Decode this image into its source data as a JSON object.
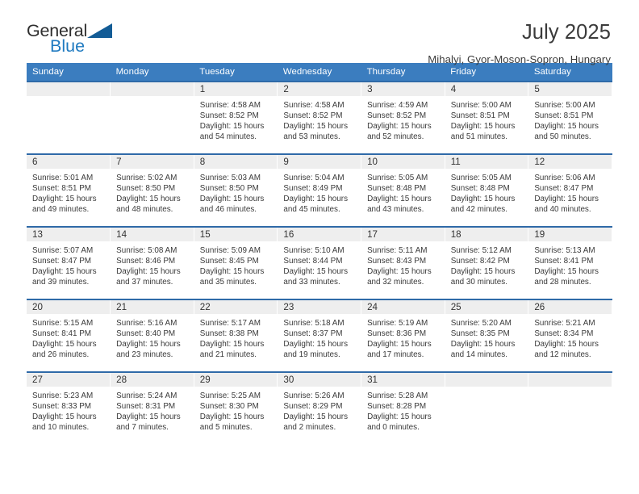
{
  "brand": {
    "name_top": "General",
    "name_bottom": "Blue",
    "accent_color": "#1f7ac0",
    "triangle_color": "#135c96"
  },
  "header": {
    "title": "July 2025",
    "subtitle": "Mihalyi, Gyor-Moson-Sopron, Hungary"
  },
  "theme": {
    "header_row_bg": "#3b7dbf",
    "week_rule": "#2f6aa8",
    "daynum_bg": "#eeeeee",
    "text": "#3a3a3a"
  },
  "weekday_headers": [
    "Sunday",
    "Monday",
    "Tuesday",
    "Wednesday",
    "Thursday",
    "Friday",
    "Saturday"
  ],
  "labels": {
    "sunrise_prefix": "Sunrise:",
    "sunset_prefix": "Sunset:",
    "daylight_prefix": "Daylight:"
  },
  "weeks": [
    [
      {
        "day": "",
        "empty": true
      },
      {
        "day": "",
        "empty": true
      },
      {
        "day": "1",
        "sunrise": "Sunrise: 4:58 AM",
        "sunset": "Sunset: 8:52 PM",
        "daylight": "Daylight: 15 hours and 54 minutes."
      },
      {
        "day": "2",
        "sunrise": "Sunrise: 4:58 AM",
        "sunset": "Sunset: 8:52 PM",
        "daylight": "Daylight: 15 hours and 53 minutes."
      },
      {
        "day": "3",
        "sunrise": "Sunrise: 4:59 AM",
        "sunset": "Sunset: 8:52 PM",
        "daylight": "Daylight: 15 hours and 52 minutes."
      },
      {
        "day": "4",
        "sunrise": "Sunrise: 5:00 AM",
        "sunset": "Sunset: 8:51 PM",
        "daylight": "Daylight: 15 hours and 51 minutes."
      },
      {
        "day": "5",
        "sunrise": "Sunrise: 5:00 AM",
        "sunset": "Sunset: 8:51 PM",
        "daylight": "Daylight: 15 hours and 50 minutes."
      }
    ],
    [
      {
        "day": "6",
        "sunrise": "Sunrise: 5:01 AM",
        "sunset": "Sunset: 8:51 PM",
        "daylight": "Daylight: 15 hours and 49 minutes."
      },
      {
        "day": "7",
        "sunrise": "Sunrise: 5:02 AM",
        "sunset": "Sunset: 8:50 PM",
        "daylight": "Daylight: 15 hours and 48 minutes."
      },
      {
        "day": "8",
        "sunrise": "Sunrise: 5:03 AM",
        "sunset": "Sunset: 8:50 PM",
        "daylight": "Daylight: 15 hours and 46 minutes."
      },
      {
        "day": "9",
        "sunrise": "Sunrise: 5:04 AM",
        "sunset": "Sunset: 8:49 PM",
        "daylight": "Daylight: 15 hours and 45 minutes."
      },
      {
        "day": "10",
        "sunrise": "Sunrise: 5:05 AM",
        "sunset": "Sunset: 8:48 PM",
        "daylight": "Daylight: 15 hours and 43 minutes."
      },
      {
        "day": "11",
        "sunrise": "Sunrise: 5:05 AM",
        "sunset": "Sunset: 8:48 PM",
        "daylight": "Daylight: 15 hours and 42 minutes."
      },
      {
        "day": "12",
        "sunrise": "Sunrise: 5:06 AM",
        "sunset": "Sunset: 8:47 PM",
        "daylight": "Daylight: 15 hours and 40 minutes."
      }
    ],
    [
      {
        "day": "13",
        "sunrise": "Sunrise: 5:07 AM",
        "sunset": "Sunset: 8:47 PM",
        "daylight": "Daylight: 15 hours and 39 minutes."
      },
      {
        "day": "14",
        "sunrise": "Sunrise: 5:08 AM",
        "sunset": "Sunset: 8:46 PM",
        "daylight": "Daylight: 15 hours and 37 minutes."
      },
      {
        "day": "15",
        "sunrise": "Sunrise: 5:09 AM",
        "sunset": "Sunset: 8:45 PM",
        "daylight": "Daylight: 15 hours and 35 minutes."
      },
      {
        "day": "16",
        "sunrise": "Sunrise: 5:10 AM",
        "sunset": "Sunset: 8:44 PM",
        "daylight": "Daylight: 15 hours and 33 minutes."
      },
      {
        "day": "17",
        "sunrise": "Sunrise: 5:11 AM",
        "sunset": "Sunset: 8:43 PM",
        "daylight": "Daylight: 15 hours and 32 minutes."
      },
      {
        "day": "18",
        "sunrise": "Sunrise: 5:12 AM",
        "sunset": "Sunset: 8:42 PM",
        "daylight": "Daylight: 15 hours and 30 minutes."
      },
      {
        "day": "19",
        "sunrise": "Sunrise: 5:13 AM",
        "sunset": "Sunset: 8:41 PM",
        "daylight": "Daylight: 15 hours and 28 minutes."
      }
    ],
    [
      {
        "day": "20",
        "sunrise": "Sunrise: 5:15 AM",
        "sunset": "Sunset: 8:41 PM",
        "daylight": "Daylight: 15 hours and 26 minutes."
      },
      {
        "day": "21",
        "sunrise": "Sunrise: 5:16 AM",
        "sunset": "Sunset: 8:40 PM",
        "daylight": "Daylight: 15 hours and 23 minutes."
      },
      {
        "day": "22",
        "sunrise": "Sunrise: 5:17 AM",
        "sunset": "Sunset: 8:38 PM",
        "daylight": "Daylight: 15 hours and 21 minutes."
      },
      {
        "day": "23",
        "sunrise": "Sunrise: 5:18 AM",
        "sunset": "Sunset: 8:37 PM",
        "daylight": "Daylight: 15 hours and 19 minutes."
      },
      {
        "day": "24",
        "sunrise": "Sunrise: 5:19 AM",
        "sunset": "Sunset: 8:36 PM",
        "daylight": "Daylight: 15 hours and 17 minutes."
      },
      {
        "day": "25",
        "sunrise": "Sunrise: 5:20 AM",
        "sunset": "Sunset: 8:35 PM",
        "daylight": "Daylight: 15 hours and 14 minutes."
      },
      {
        "day": "26",
        "sunrise": "Sunrise: 5:21 AM",
        "sunset": "Sunset: 8:34 PM",
        "daylight": "Daylight: 15 hours and 12 minutes."
      }
    ],
    [
      {
        "day": "27",
        "sunrise": "Sunrise: 5:23 AM",
        "sunset": "Sunset: 8:33 PM",
        "daylight": "Daylight: 15 hours and 10 minutes."
      },
      {
        "day": "28",
        "sunrise": "Sunrise: 5:24 AM",
        "sunset": "Sunset: 8:31 PM",
        "daylight": "Daylight: 15 hours and 7 minutes."
      },
      {
        "day": "29",
        "sunrise": "Sunrise: 5:25 AM",
        "sunset": "Sunset: 8:30 PM",
        "daylight": "Daylight: 15 hours and 5 minutes."
      },
      {
        "day": "30",
        "sunrise": "Sunrise: 5:26 AM",
        "sunset": "Sunset: 8:29 PM",
        "daylight": "Daylight: 15 hours and 2 minutes."
      },
      {
        "day": "31",
        "sunrise": "Sunrise: 5:28 AM",
        "sunset": "Sunset: 8:28 PM",
        "daylight": "Daylight: 15 hours and 0 minutes."
      },
      {
        "day": "",
        "empty": true
      },
      {
        "day": "",
        "empty": true
      }
    ]
  ]
}
